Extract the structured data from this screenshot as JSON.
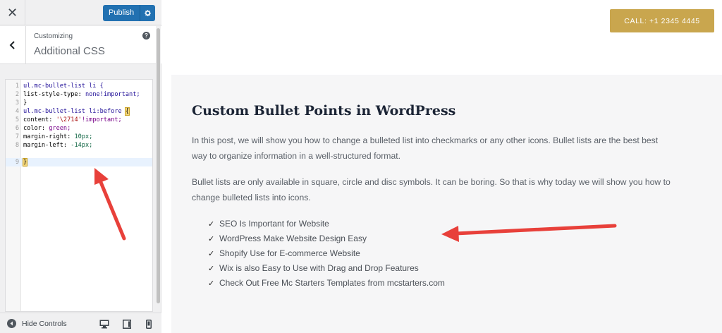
{
  "customizer": {
    "close_label": "✕",
    "publish_label": "Publish",
    "breadcrumb": "Customizing",
    "section_title": "Additional CSS",
    "help_label": "?",
    "hide_controls_label": "Hide Controls"
  },
  "css_editor": {
    "line_numbers": [
      "1",
      "2",
      "3",
      "4",
      "5",
      "6",
      "7",
      "8",
      "9"
    ],
    "lines": {
      "l1": "ul.mc-bullet-list li {",
      "l2_prop": "list-style-type: ",
      "l2_val": "none!important;",
      "l3": "}",
      "l4_sel": "ul.mc-bullet-list li:before ",
      "l4_brace": "{",
      "l5_prop": "content: ",
      "l5_str": "'\\2714'",
      "l5_imp": "!important;",
      "l6_prop": "color: ",
      "l6_val": "green;",
      "l7_prop": "margin-right: ",
      "l7_val": "10px;",
      "l8_prop": "margin-left: ",
      "l8_val": "-14px;",
      "l9": "}"
    }
  },
  "preview": {
    "call_button": "CALL: +1 2345 4445",
    "post_title": "Custom Bullet Points in WordPress",
    "para1_line1": "In this post, we will show you how to change a bulleted list into checkmarks or any other icons. Bullet lists are the best best",
    "para1_line2": "way to organize information in a well-structured format.",
    "para2_line1": "Bullet lists are only available in square, circle and disc symbols. It can be boring. So that is why today we will show you how to",
    "para2_line2": "change bulleted lists into icons.",
    "check_glyph": "✓",
    "bullets": [
      "SEO Is Important for Website",
      "WordPress Make Website Design Easy",
      "Shopify Use for E-commerce Website",
      "Wix is also Easy to Use with Drag and Drop Features",
      "Check Out Free Mc Starters Templates from mcstarters.com"
    ]
  },
  "colors": {
    "publish_blue": "#2271b1",
    "call_gold": "#c9a64e",
    "annotation_red": "#e8403a"
  }
}
